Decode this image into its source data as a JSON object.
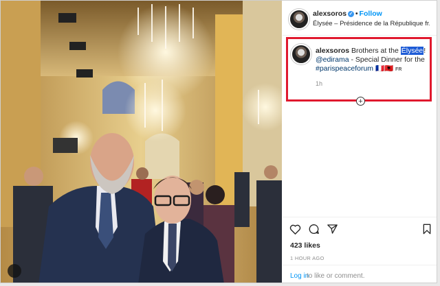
{
  "post": {
    "username": "alexsoros",
    "follow_label": "Follow",
    "location": "Élysée – Présidence de la République fr...",
    "caption": {
      "prefix": "Brothers at the ",
      "highlight": "Élysée",
      "suffix": "!",
      "mention": "@edirama",
      "text2": " - Special Dinner for the",
      "hashtag": "#parispeaceforum",
      "flags": "🇫🇷🇦🇱",
      "fr_label": "FR"
    },
    "caption_time": "1h",
    "likes": "423 likes",
    "time_ago": "1 HOUR AGO",
    "login_link": "Log in",
    "login_rest": " to like or comment."
  },
  "icons": {
    "verified": "verified-badge-icon",
    "like": "heart-icon",
    "comment": "comment-bubble-icon",
    "share": "paper-plane-icon",
    "save": "bookmark-icon",
    "drag": "move-cursor-icon"
  },
  "colors": {
    "accent": "#0095f6",
    "highlight_box": "#e0182d",
    "selection": "#1d5bd6",
    "text": "#262626",
    "muted": "#8e8e8e"
  }
}
